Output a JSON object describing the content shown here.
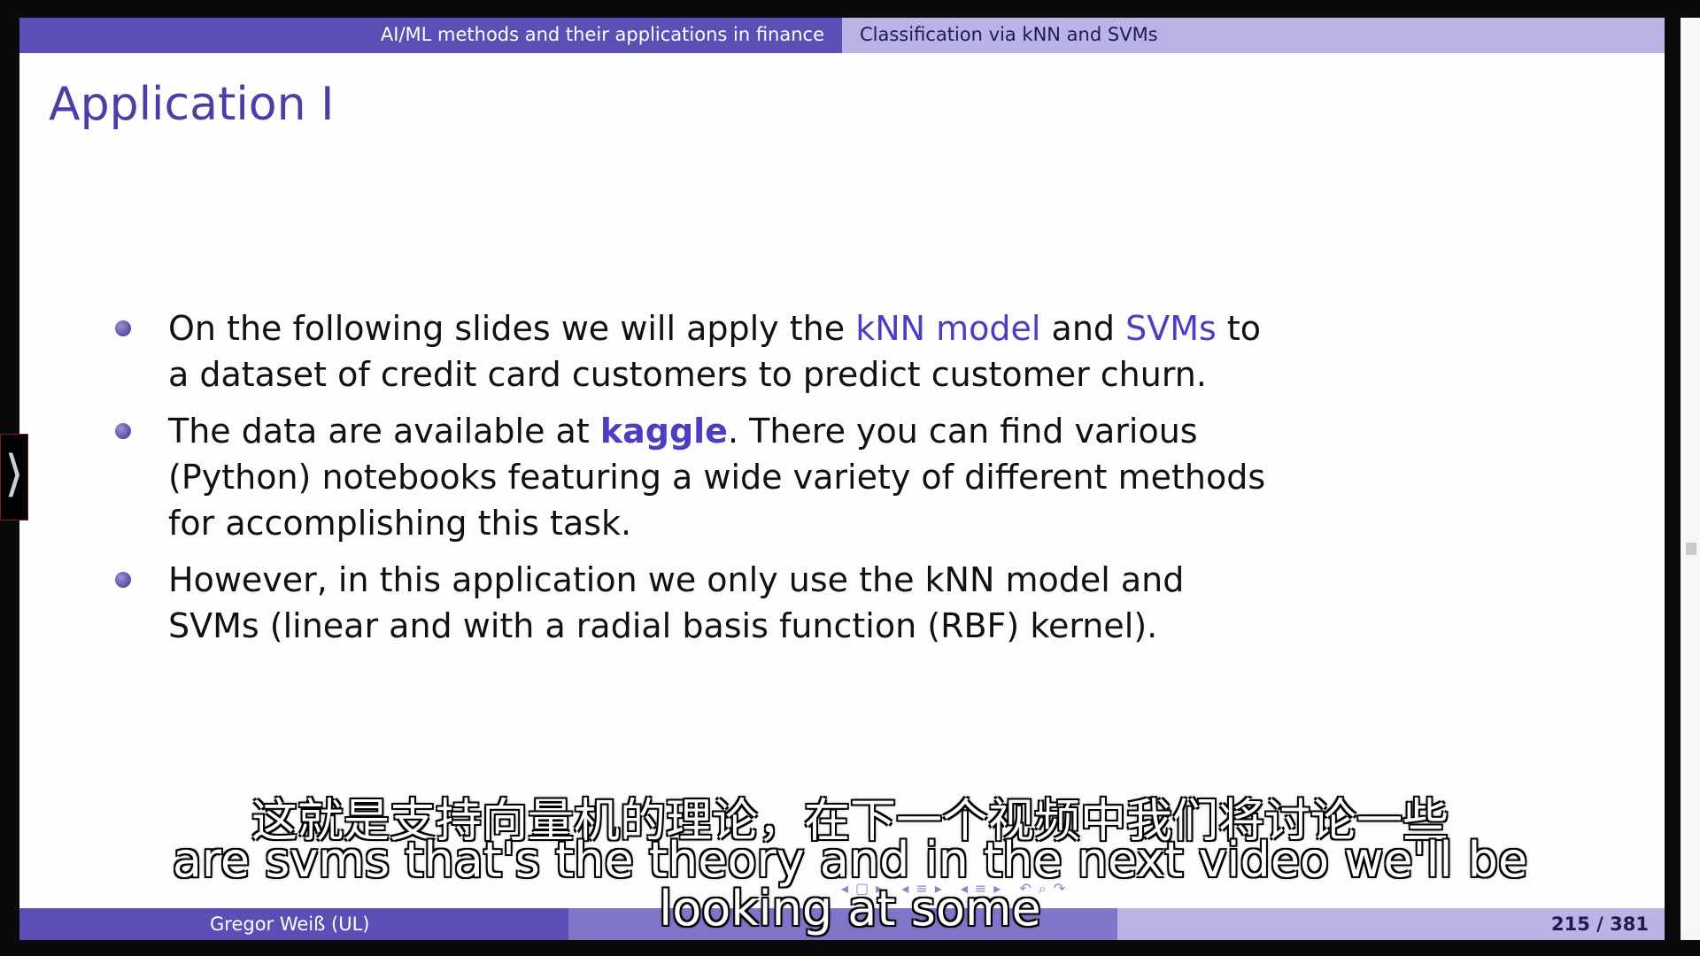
{
  "header": {
    "left_title": "AI/ML methods and their applications in finance",
    "right_title": "Classification via kNN and SVMs"
  },
  "frame_title": "Application I",
  "bullets": [
    {
      "pre": "On the following slides we will apply the ",
      "hl1": "kNN model",
      "mid": " and ",
      "hl2": "SVMs",
      "post": " to a dataset of credit card customers to predict customer churn."
    },
    {
      "pre": "The data are available at ",
      "hl": "kaggle",
      "post": ". There you can find various (Python) notebooks featuring a wide variety of different methods for accomplishing this task."
    },
    {
      "text": "However, in this application we only use the kNN model and SVMs (linear and with a radial basis function (RBF) kernel)."
    }
  ],
  "footer": {
    "author": "Gregor Weiß  (UL)",
    "page": "215 / 381"
  },
  "nav_icons": [
    "nav-frame-icon",
    "nav-subsection-icon",
    "nav-section-icon",
    "nav-search-icon"
  ],
  "subtitles": {
    "chinese": "这就是支持向量机的理论，在下一个视频中我们将讨论一些",
    "english_line1": "are svms that's the theory and in the next video we'll be",
    "english_line2": "looking at some"
  },
  "side_tab_glyph": "⟩",
  "colors": {
    "theme_dark": "#5a4fb4",
    "theme_light": "#b9b4e3",
    "highlight": "#4a3fc2"
  }
}
